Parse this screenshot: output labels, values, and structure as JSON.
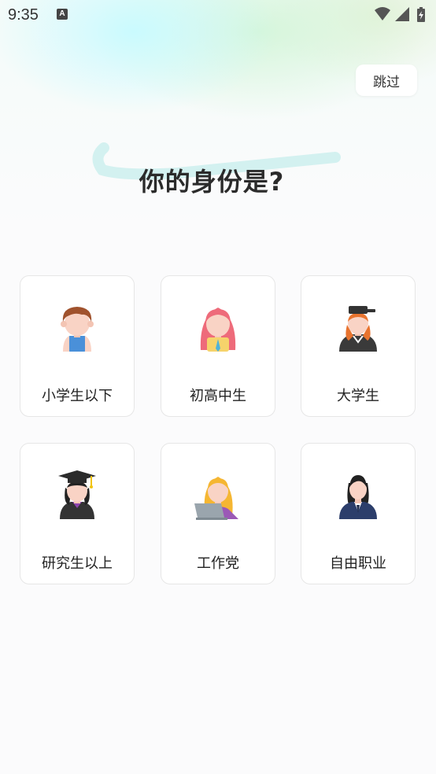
{
  "status_bar": {
    "time": "9:35",
    "notification_badge": "A"
  },
  "header": {
    "skip_label": "跳过",
    "title": "你的身份是?"
  },
  "identities": [
    {
      "label": "小学生以下",
      "icon": "elementary-student-icon"
    },
    {
      "label": "初高中生",
      "icon": "middle-school-student-icon"
    },
    {
      "label": "大学生",
      "icon": "college-student-icon"
    },
    {
      "label": "研究生以上",
      "icon": "graduate-icon"
    },
    {
      "label": "工作党",
      "icon": "office-worker-icon"
    },
    {
      "label": "自由职业",
      "icon": "freelancer-icon"
    }
  ],
  "colors": {
    "accent_brush": "#c8efef",
    "skin": "#f9d3c5",
    "title": "#2b2b2b"
  }
}
